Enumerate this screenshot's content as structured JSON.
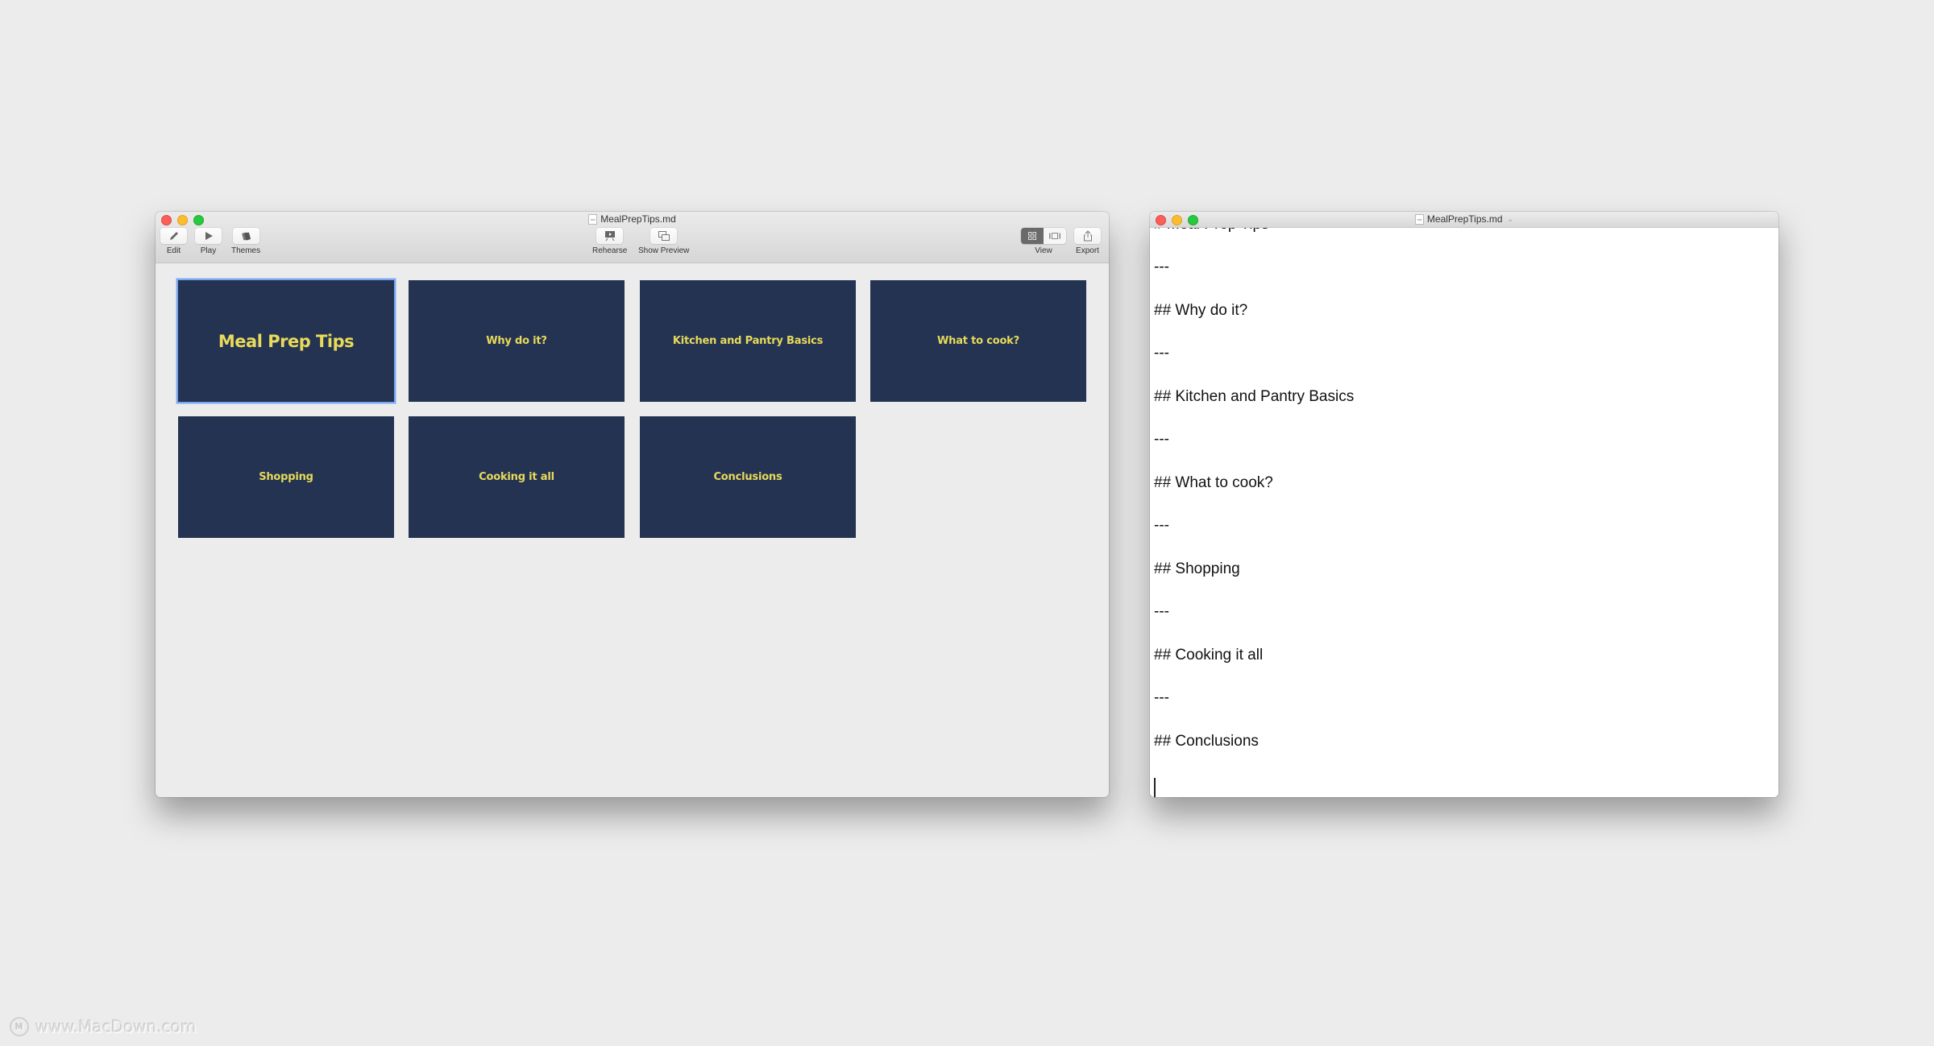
{
  "left_window": {
    "title": "MealPrepTips.md",
    "toolbar_left": [
      {
        "label": "Edit",
        "icon": "pencil-icon"
      },
      {
        "label": "Play",
        "icon": "play-icon"
      },
      {
        "label": "Themes",
        "icon": "themes-icon"
      }
    ],
    "toolbar_center": [
      {
        "label": "Rehearse",
        "icon": "rehearse-icon"
      },
      {
        "label": "Show Preview",
        "icon": "show-preview-icon"
      }
    ],
    "view": {
      "label": "View",
      "options": [
        "grid",
        "slide"
      ],
      "selected": "grid"
    },
    "export": {
      "label": "Export",
      "icon": "share-icon"
    },
    "slides": [
      {
        "title": "Meal Prep Tips",
        "selected": true
      },
      {
        "title": "Why do it?",
        "selected": false
      },
      {
        "title": "Kitchen and Pantry Basics",
        "selected": false
      },
      {
        "title": "What to cook?",
        "selected": false
      },
      {
        "title": "Shopping",
        "selected": false
      },
      {
        "title": "Cooking it all",
        "selected": false
      },
      {
        "title": "Conclusions",
        "selected": false
      }
    ],
    "colors": {
      "slide_bg": "#243352",
      "slide_text": "#e8da5a",
      "selection": "#7aa7ef"
    }
  },
  "right_window": {
    "title": "MealPrepTips.md",
    "lines": [
      "# Meal Prep Tips",
      "---",
      "## Why do it?",
      "---",
      "## Kitchen and Pantry Basics",
      "---",
      "## What to cook?",
      "---",
      "## Shopping",
      "---",
      "## Cooking it all",
      "---",
      "## Conclusions"
    ]
  },
  "watermark": "www.MacDown.com"
}
